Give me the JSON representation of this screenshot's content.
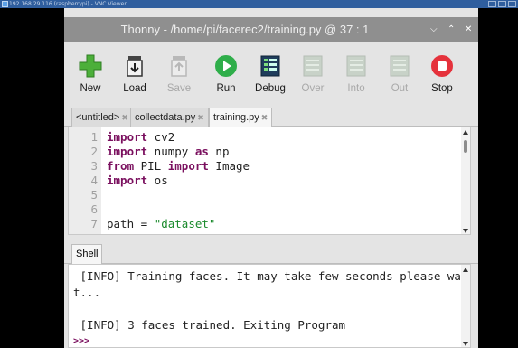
{
  "vnc": {
    "title": "192.168.29.116 (raspberrypi) - VNC Viewer"
  },
  "window": {
    "title": "Thonny - /home/pi/facerec2/training.py @ 37 : 1"
  },
  "toolbar": [
    {
      "label": "New",
      "icon": "new-plus-icon",
      "enabled": true
    },
    {
      "label": "Load",
      "icon": "load-jar-icon",
      "enabled": true
    },
    {
      "label": "Save",
      "icon": "save-jar-icon",
      "enabled": false
    },
    {
      "label": "Run",
      "icon": "run-play-icon",
      "enabled": true
    },
    {
      "label": "Debug",
      "icon": "debug-icon",
      "enabled": true
    },
    {
      "label": "Over",
      "icon": "step-over-icon",
      "enabled": false
    },
    {
      "label": "Into",
      "icon": "step-into-icon",
      "enabled": false
    },
    {
      "label": "Out",
      "icon": "step-out-icon",
      "enabled": false
    },
    {
      "label": "Stop",
      "icon": "stop-icon",
      "enabled": true
    }
  ],
  "tabs": [
    "<untitled>",
    "collectdata.py",
    "training.py"
  ],
  "tab_close": "✖",
  "editor": {
    "line_numbers": [
      "1",
      "2",
      "3",
      "4",
      "5",
      "6",
      "7"
    ],
    "lines": [
      [
        {
          "t": "import",
          "k": "kw"
        },
        {
          "t": " cv2",
          "k": ""
        }
      ],
      [
        {
          "t": "import",
          "k": "kw"
        },
        {
          "t": " numpy ",
          "k": ""
        },
        {
          "t": "as",
          "k": "kw"
        },
        {
          "t": " np",
          "k": ""
        }
      ],
      [
        {
          "t": "from",
          "k": "kw"
        },
        {
          "t": " PIL ",
          "k": ""
        },
        {
          "t": "import",
          "k": "kw"
        },
        {
          "t": " Image",
          "k": ""
        }
      ],
      [
        {
          "t": "import",
          "k": "kw"
        },
        {
          "t": " os",
          "k": ""
        }
      ],
      [],
      [],
      [
        {
          "t": "path = ",
          "k": ""
        },
        {
          "t": "\"dataset\"",
          "k": "str"
        }
      ]
    ]
  },
  "shell": {
    "tab": "Shell",
    "lines": [
      " [INFO] Training faces. It may take few seconds please wai",
      "t...",
      "",
      " [INFO] 3 faces trained. Exiting Program"
    ],
    "prompt": ">>>"
  },
  "colors": {
    "keyword": "#7a0f5e",
    "string": "#1a8a2c",
    "titlebar": "#8f8f8f"
  }
}
